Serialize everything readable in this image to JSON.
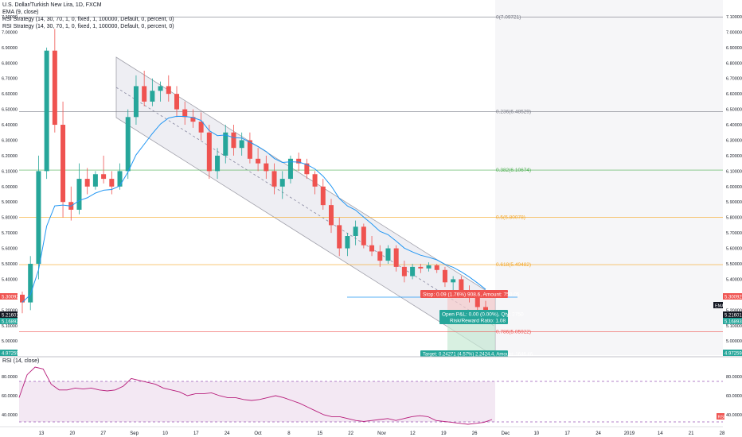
{
  "header": {
    "title": "U.S. Dollar/Turkish New Lira, 1D, FXCM",
    "indicators": [
      "EMA (9, close)",
      "RSI Strategy (14, 30, 70, 1, 0, fixed, 1, 100000, Default, 0, percent, 0)",
      "RSI Strategy (14, 30, 70, 1, 0, fixed, 1, 100000, Default, 0, percent, 0)"
    ]
  },
  "rsi_panel": {
    "label": "RSI (14, close)"
  },
  "badges": {
    "price_left": "5.30092",
    "price_mid1": "5.21601",
    "price_mid2": "5.16893",
    "price_bottom": "4.97259",
    "ema_tag": "EMA",
    "rsi_tag": "RSI"
  },
  "trade_boxes": {
    "stop": "Stop: 0.09 (1.76%) 908.6, Amount: 750.05",
    "open": "Open P&L: 0.00 (0.00%), Qty: 2750",
    "rr": "Risk/Reward Ratio: 1.08",
    "target": "Target: 0.24271 (4.57%) 2.2424.4, Amount: 1646.46"
  },
  "colors": {
    "up": "#26a69a",
    "down": "#ef5350",
    "ema": "#2196f3",
    "fib_level": "#f5a623",
    "channel_fill": "#e8e8ee",
    "rsi": "#b71c7a",
    "rsi_band": "#efe0f0"
  },
  "chart_data": {
    "type": "candlestick",
    "title": "U.S. Dollar/Turkish New Lira, 1D, FXCM",
    "y_ticks": [
      "7.10000",
      "7.00000",
      "6.90000",
      "6.80000",
      "6.70000",
      "6.60000",
      "6.50000",
      "6.40000",
      "6.30000",
      "6.20000",
      "6.10000",
      "6.00000",
      "5.90000",
      "5.80000",
      "5.70000",
      "5.60000",
      "5.50000",
      "5.40000",
      "5.30000",
      "5.20000",
      "5.10000",
      "5.00000"
    ],
    "x_ticks": [
      "13",
      "20",
      "27",
      "Sep",
      "10",
      "17",
      "24",
      "Oct",
      "8",
      "15",
      "22",
      "Nov",
      "12",
      "19",
      "26",
      "Dec",
      "10",
      "17",
      "24",
      "2019",
      "14",
      "21",
      "28"
    ],
    "ylim": [
      4.96,
      7.11
    ],
    "fib_levels": [
      {
        "label": "0(7.09721)",
        "value": 7.09721
      },
      {
        "label": "0.236(6.48529)",
        "value": 6.48529
      },
      {
        "label": "0.382(6.10674)",
        "value": 6.10674
      },
      {
        "label": "0.5(5.80078)",
        "value": 5.80078
      },
      {
        "label": "0.618(5.49482)",
        "value": 5.49482
      },
      {
        "label": "0.786(5.05922)",
        "value": 5.05922
      }
    ],
    "candles": [
      [
        5.3,
        5.32,
        5.18,
        5.25
      ],
      [
        5.25,
        5.55,
        5.2,
        5.5
      ],
      [
        5.5,
        6.2,
        5.4,
        6.1
      ],
      [
        6.1,
        6.9,
        6.05,
        6.88
      ],
      [
        6.88,
        7.02,
        6.35,
        6.4
      ],
      [
        6.4,
        6.55,
        5.8,
        5.9
      ],
      [
        5.9,
        6.0,
        5.78,
        5.85
      ],
      [
        5.85,
        6.15,
        5.82,
        6.05
      ],
      [
        6.05,
        6.12,
        5.95,
        6.0
      ],
      [
        6.0,
        6.1,
        5.98,
        6.08
      ],
      [
        6.08,
        6.2,
        6.02,
        6.05
      ],
      [
        6.05,
        6.1,
        5.95,
        6.0
      ],
      [
        6.0,
        6.15,
        5.98,
        6.1
      ],
      [
        6.1,
        6.5,
        6.05,
        6.45
      ],
      [
        6.45,
        6.72,
        6.4,
        6.65
      ],
      [
        6.65,
        6.75,
        6.52,
        6.55
      ],
      [
        6.55,
        6.7,
        6.52,
        6.62
      ],
      [
        6.62,
        6.68,
        6.55,
        6.65
      ],
      [
        6.65,
        6.72,
        6.55,
        6.6
      ],
      [
        6.6,
        6.65,
        6.45,
        6.5
      ],
      [
        6.5,
        6.55,
        6.4,
        6.45
      ],
      [
        6.45,
        6.5,
        6.38,
        6.42
      ],
      [
        6.42,
        6.48,
        6.3,
        6.35
      ],
      [
        6.35,
        6.4,
        6.05,
        6.1
      ],
      [
        6.1,
        6.25,
        6.05,
        6.2
      ],
      [
        6.2,
        6.4,
        6.15,
        6.35
      ],
      [
        6.35,
        6.4,
        6.2,
        6.25
      ],
      [
        6.25,
        6.35,
        6.2,
        6.3
      ],
      [
        6.3,
        6.35,
        6.15,
        6.18
      ],
      [
        6.18,
        6.25,
        6.1,
        6.15
      ],
      [
        6.15,
        6.2,
        6.05,
        6.1
      ],
      [
        6.1,
        6.15,
        5.95,
        6.0
      ],
      [
        6.0,
        6.1,
        5.92,
        6.05
      ],
      [
        6.05,
        6.2,
        6.02,
        6.18
      ],
      [
        6.18,
        6.22,
        6.1,
        6.15
      ],
      [
        6.15,
        6.18,
        6.05,
        6.08
      ],
      [
        6.08,
        6.1,
        5.95,
        6.0
      ],
      [
        6.0,
        6.05,
        5.85,
        5.88
      ],
      [
        5.88,
        5.92,
        5.7,
        5.75
      ],
      [
        5.75,
        5.8,
        5.55,
        5.6
      ],
      [
        5.6,
        5.7,
        5.55,
        5.68
      ],
      [
        5.68,
        5.78,
        5.62,
        5.74
      ],
      [
        5.74,
        5.76,
        5.6,
        5.62
      ],
      [
        5.62,
        5.68,
        5.55,
        5.58
      ],
      [
        5.58,
        5.62,
        5.48,
        5.52
      ],
      [
        5.52,
        5.62,
        5.5,
        5.6
      ],
      [
        5.6,
        5.62,
        5.45,
        5.48
      ],
      [
        5.48,
        5.52,
        5.38,
        5.42
      ],
      [
        5.42,
        5.5,
        5.4,
        5.48
      ],
      [
        5.48,
        5.5,
        5.44,
        5.47
      ],
      [
        5.47,
        5.51,
        5.45,
        5.49
      ],
      [
        5.49,
        5.5,
        5.44,
        5.46
      ],
      [
        5.46,
        5.48,
        5.35,
        5.38
      ],
      [
        5.38,
        5.42,
        5.32,
        5.4
      ],
      [
        5.4,
        5.42,
        5.3,
        5.33
      ],
      [
        5.33,
        5.36,
        5.25,
        5.28
      ],
      [
        5.28,
        5.3,
        5.18,
        5.22
      ],
      [
        5.22,
        5.26,
        5.15,
        5.17
      ]
    ],
    "rsi": {
      "ylim": [
        30,
        90
      ],
      "y_ticks": [
        "80.0000",
        "60.0000",
        "40.0000"
      ],
      "overbought": 70,
      "oversold": 30,
      "values": [
        58,
        82,
        90,
        88,
        72,
        66,
        66,
        68,
        67,
        68,
        66,
        65,
        66,
        70,
        78,
        76,
        74,
        72,
        68,
        66,
        64,
        60,
        62,
        62,
        63,
        60,
        58,
        58,
        56,
        55,
        56,
        58,
        60,
        58,
        55,
        52,
        48,
        44,
        40,
        38,
        38,
        36,
        34,
        33,
        34,
        35,
        36,
        34,
        36,
        38,
        39,
        38,
        34,
        33,
        32,
        31,
        30,
        31,
        32,
        35
      ]
    }
  }
}
